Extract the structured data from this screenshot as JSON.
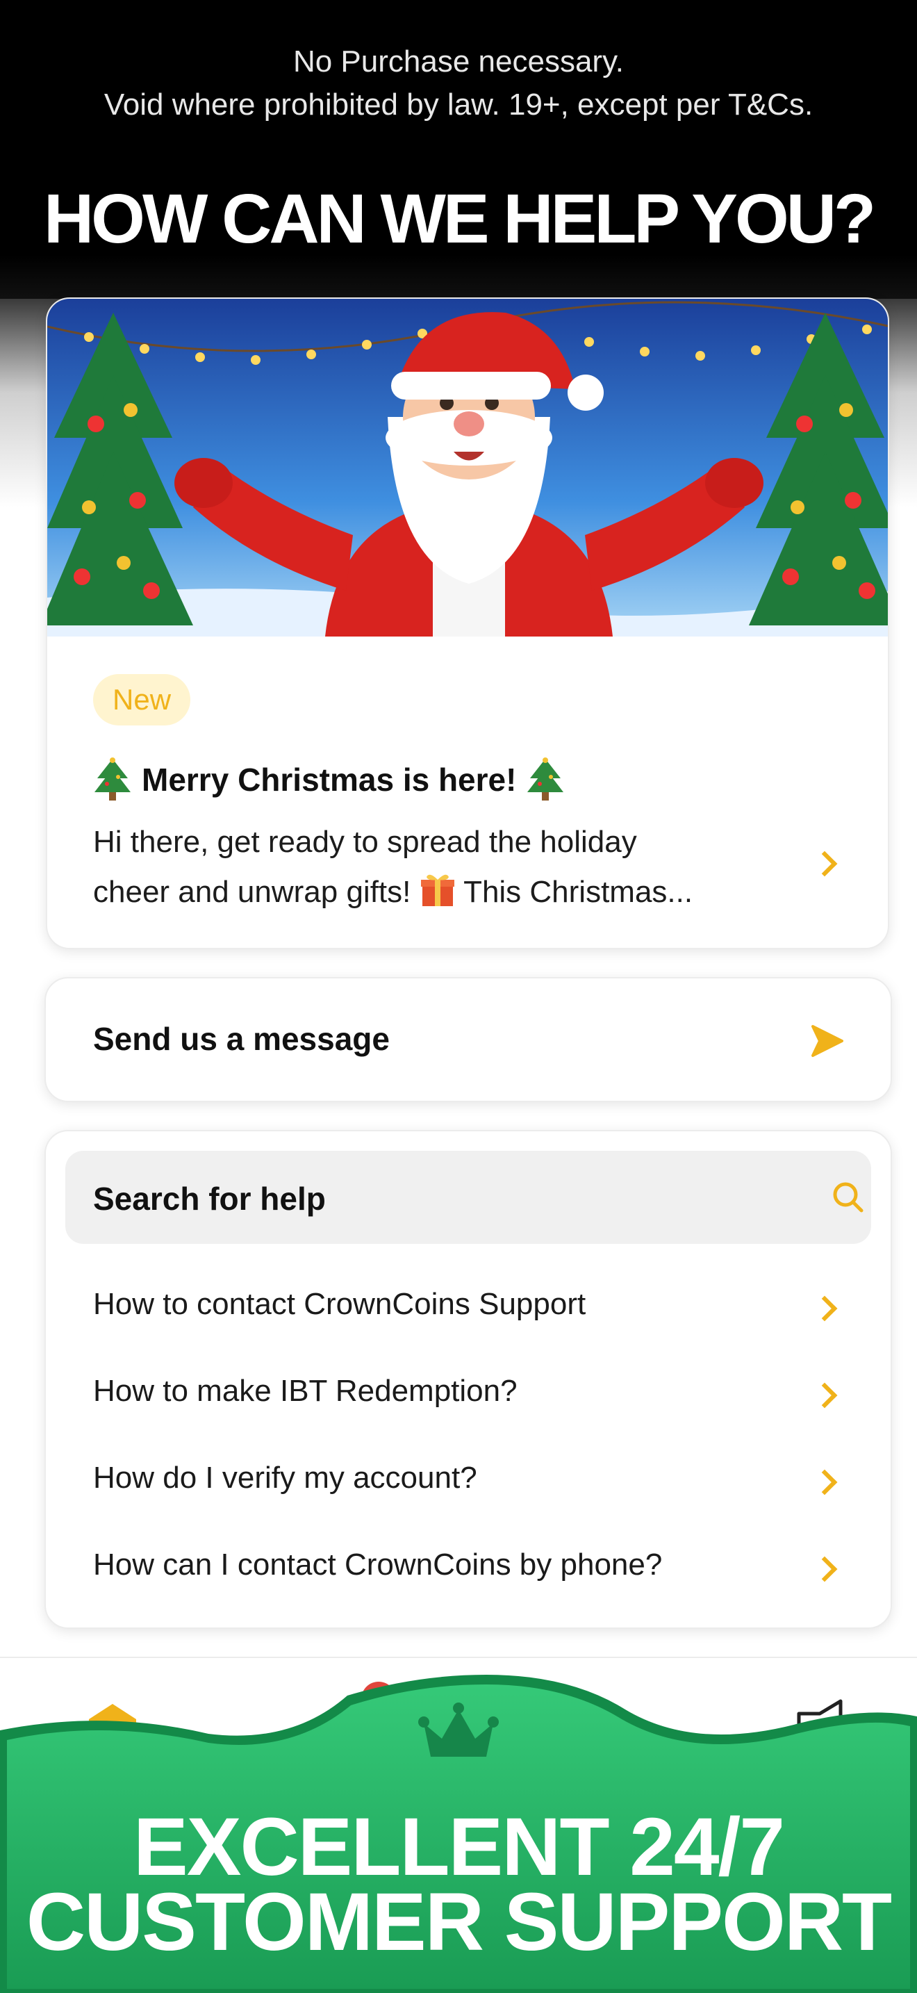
{
  "promo": {
    "disclaimer_line1": "No Purchase necessary.",
    "disclaimer_line2": "Void where prohibited by law. 19+, except per T&Cs.",
    "headline": "HOW CAN WE HELP YOU?",
    "footer_line1": "EXCELLENT 24/7",
    "footer_line2": "CUSTOMER SUPPORT"
  },
  "news": {
    "badge": "New",
    "title": "Merry Christmas is here!",
    "body_line1": "Hi there, get ready to spread the holiday",
    "body_line2_before": "cheer and unwrap gifts!",
    "body_line2_after": "This Christmas..."
  },
  "message": {
    "label": "Send us a message"
  },
  "help": {
    "search_label": "Search for help",
    "items": [
      {
        "label": "How to contact CrownCoins Support"
      },
      {
        "label": "How to make IBT Redemption?"
      },
      {
        "label": "How do I verify my account?"
      },
      {
        "label": "How can I contact CrownCoins by phone?"
      }
    ]
  },
  "icons": {
    "news_chevron": "chevron-right-icon",
    "send": "send-arrow-icon",
    "search": "search-icon",
    "nav_home": "home-icon",
    "nav_announcements": "megaphone-icon",
    "brand": "crown-icon"
  },
  "colors": {
    "accent": "#f0b21a",
    "badge_bg": "#fff4cf",
    "brand_green": "#1fa85c",
    "brand_green_light": "#35c978"
  }
}
